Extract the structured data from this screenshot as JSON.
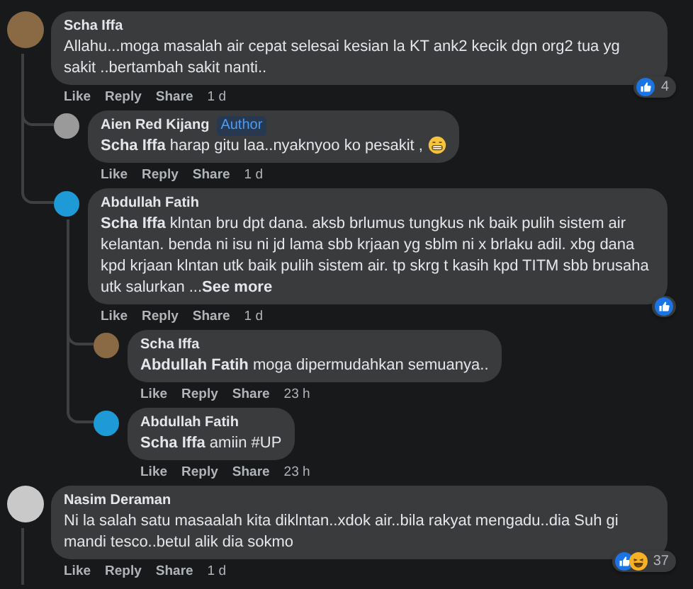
{
  "comments": [
    {
      "name": "Scha Iffa",
      "color": "#8a6a45",
      "text": "Allahu...moga masalah air cepat selesai kesian la KT ank2 kecik dgn org2 tua yg sakit ..bertambah sakit nanti..",
      "actions": [
        "Like",
        "Reply",
        "Share"
      ],
      "time": "1 d",
      "reactions": {
        "like": true,
        "count": "4"
      },
      "children": [
        {
          "name": "Aien Red Kijang",
          "badge": "Author",
          "color": "#9a9a9a",
          "text": "**Scha Iffa** harap gitu laa..nyaknyoo ko pesakit ,",
          "grimace_emoji": true,
          "actions": [
            "Like",
            "Reply",
            "Share"
          ],
          "time": "1 d"
        },
        {
          "name": "Abdullah Fatih",
          "color": "#1e9bd7",
          "text": "**Scha Iffa** klntan bru dpt dana. aksb brlumus tungkus nk baik pulih sistem air kelantan. benda ni isu ni jd lama sbb krjaan yg sblm ni x brlaku adil. xbg dana kpd krjaan klntan utk baik pulih sistem air. tp skrg t kasih kpd TITM sbb brusaha utk salurkan ...",
          "see_more": "See more",
          "actions": [
            "Like",
            "Reply",
            "Share"
          ],
          "time": "1 d",
          "reactions": {
            "like": true
          },
          "children": [
            {
              "name": "Scha Iffa",
              "color": "#8a6a45",
              "text": "**Abdullah Fatih** moga dipermudahkan semuanya..",
              "actions": [
                "Like",
                "Reply",
                "Share"
              ],
              "time": "23 h"
            },
            {
              "name": "Abdullah Fatih",
              "color": "#1e9bd7",
              "text": "**Scha Iffa** amiin #UP",
              "actions": [
                "Like",
                "Reply",
                "Share"
              ],
              "time": "23 h"
            }
          ]
        }
      ]
    },
    {
      "name": "Nasim Deraman",
      "color": "#c9c9c9",
      "text": "Ni la salah satu masaalah kita diklntan..xdok air..bila rakyat mengadu..dia Suh gi mandi tesco..betul alik dia sokmo",
      "actions": [
        "Like",
        "Reply",
        "Share"
      ],
      "time": "1 d",
      "reactions": {
        "like": true,
        "haha": true,
        "count": "37"
      },
      "thread_continues": true
    }
  ]
}
